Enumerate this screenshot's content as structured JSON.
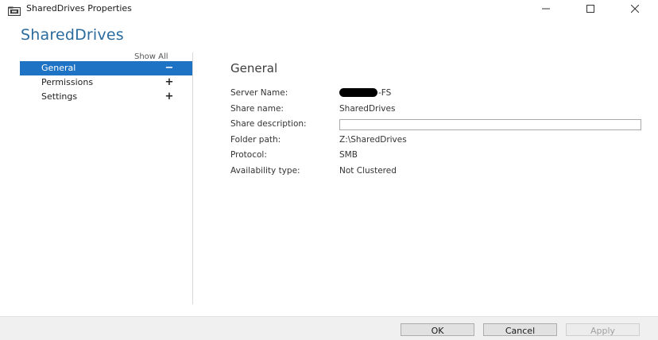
{
  "window": {
    "title": "SharedDrives Properties",
    "controls": [
      "minimize-icon",
      "maximize-icon",
      "close-icon"
    ]
  },
  "header": {
    "title": "SharedDrives"
  },
  "nav": {
    "show_all": "Show All",
    "items": [
      {
        "label": "General",
        "sign": "−",
        "selected": true
      },
      {
        "label": "Permissions",
        "sign": "+",
        "selected": false
      },
      {
        "label": "Settings",
        "sign": "+",
        "selected": false
      }
    ]
  },
  "content": {
    "section_title": "General",
    "properties": [
      {
        "label": "Server Name:",
        "value": "-FS",
        "redacted_prefix": true
      },
      {
        "label": "Share name:",
        "value": "SharedDrives"
      },
      {
        "label": "Share description:",
        "value": ""
      },
      {
        "label": "Folder path:",
        "value": "Z:\\SharedDrives"
      },
      {
        "label": "Protocol:",
        "value": "SMB"
      },
      {
        "label": "Availability type:",
        "value": "Not Clustered"
      }
    ]
  },
  "footer": {
    "ok_label": "OK",
    "cancel_label": "Cancel",
    "apply_label": "Apply"
  },
  "colors": {
    "accent": "#1f73c4",
    "header_title": "#2b6b9e"
  }
}
